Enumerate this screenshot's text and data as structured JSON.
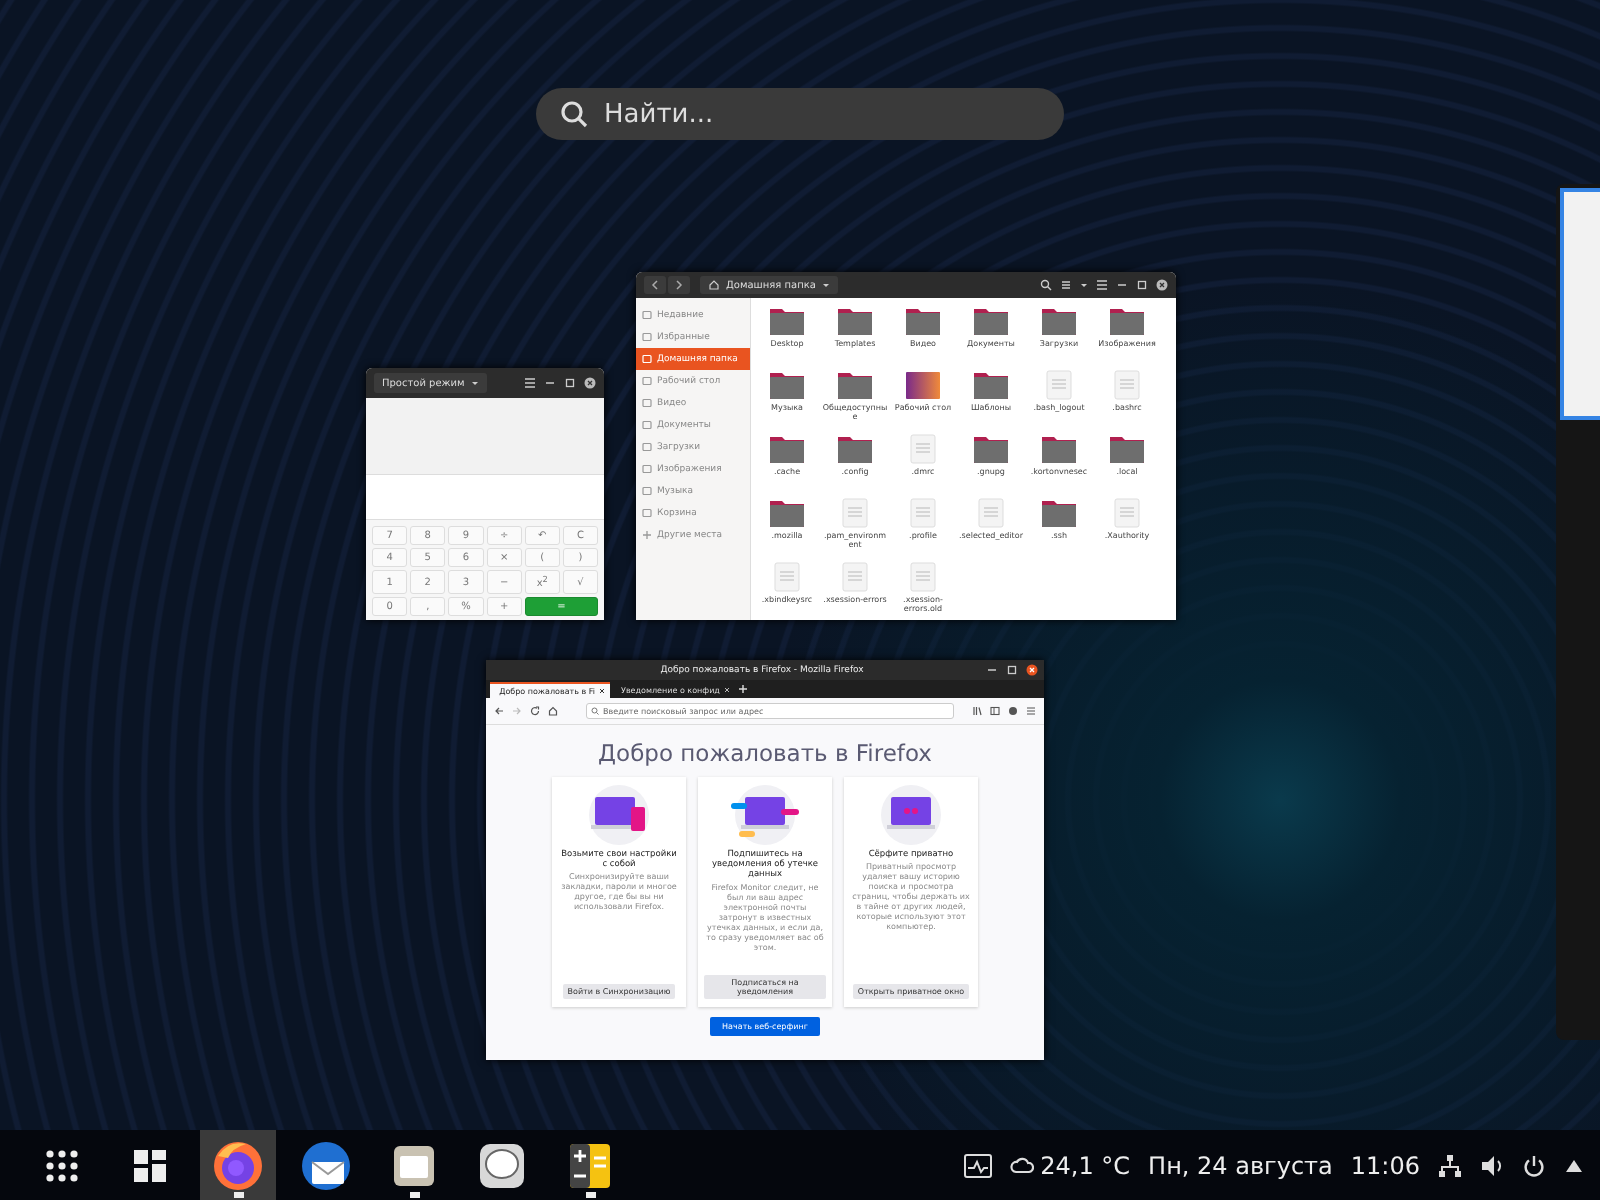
{
  "search": {
    "placeholder": "Найти..."
  },
  "windows": [
    {
      "kind": "calculator",
      "mode": "Простой режим",
      "keys": [
        {
          "label": "7",
          "kind": "key"
        },
        {
          "label": "8",
          "kind": "key"
        },
        {
          "label": "9",
          "kind": "key"
        },
        {
          "label": "÷",
          "kind": "key"
        },
        {
          "label": "↶",
          "kind": "key"
        },
        {
          "label": "C",
          "kind": "key"
        },
        {
          "label": "4",
          "kind": "key"
        },
        {
          "label": "5",
          "kind": "key"
        },
        {
          "label": "6",
          "kind": "key"
        },
        {
          "label": "×",
          "kind": "key"
        },
        {
          "label": "(",
          "kind": "key"
        },
        {
          "label": ")",
          "kind": "key"
        },
        {
          "label": "1",
          "kind": "key"
        },
        {
          "label": "2",
          "kind": "key"
        },
        {
          "label": "3",
          "kind": "key"
        },
        {
          "label": "−",
          "kind": "key"
        },
        {
          "label": "x$^{2}$",
          "kind": "key"
        },
        {
          "label": "√",
          "kind": "key"
        },
        {
          "label": "0",
          "kind": "key"
        },
        {
          "label": ",",
          "kind": "key"
        },
        {
          "label": "%",
          "kind": "key"
        },
        {
          "label": "+",
          "kind": "key"
        },
        {
          "label": "=",
          "kind": "equals"
        }
      ]
    },
    {
      "kind": "files",
      "path": "Домашняя папка",
      "sidebar": [
        {
          "label": "Недавние",
          "kind": "place",
          "selected": false
        },
        {
          "label": "Избранные",
          "kind": "place",
          "selected": false
        },
        {
          "label": "Домашняя папка",
          "kind": "place",
          "selected": true
        },
        {
          "label": "Рабочий стол",
          "kind": "place",
          "selected": false
        },
        {
          "label": "Видео",
          "kind": "place",
          "selected": false
        },
        {
          "label": "Документы",
          "kind": "place",
          "selected": false
        },
        {
          "label": "Загрузки",
          "kind": "place",
          "selected": false
        },
        {
          "label": "Изображения",
          "kind": "place",
          "selected": false
        },
        {
          "label": "Музыка",
          "kind": "place",
          "selected": false
        },
        {
          "label": "Корзина",
          "kind": "place",
          "selected": false
        },
        {
          "label": "Другие места",
          "kind": "add",
          "selected": false
        }
      ],
      "items": [
        {
          "name": "Desktop",
          "kind": "folder"
        },
        {
          "name": "Templates",
          "kind": "folder"
        },
        {
          "name": "Видео",
          "kind": "folder"
        },
        {
          "name": "Документы",
          "kind": "folder"
        },
        {
          "name": "Загрузки",
          "kind": "folder"
        },
        {
          "name": "Изображения",
          "kind": "folder"
        },
        {
          "name": "Музыка",
          "kind": "folder"
        },
        {
          "name": "Общедоступные",
          "kind": "folder"
        },
        {
          "name": "Рабочий стол",
          "kind": "desktop"
        },
        {
          "name": "Шаблоны",
          "kind": "folder"
        },
        {
          "name": ".bash_logout",
          "kind": "file"
        },
        {
          "name": ".bashrc",
          "kind": "file"
        },
        {
          "name": ".cache",
          "kind": "folder"
        },
        {
          "name": ".config",
          "kind": "folder"
        },
        {
          "name": ".dmrc",
          "kind": "file"
        },
        {
          "name": ".gnupg",
          "kind": "folder"
        },
        {
          "name": ".kortonvnesec",
          "kind": "folder"
        },
        {
          "name": ".local",
          "kind": "folder"
        },
        {
          "name": ".mozilla",
          "kind": "folder"
        },
        {
          "name": ".pam_environment",
          "kind": "file"
        },
        {
          "name": ".profile",
          "kind": "file"
        },
        {
          "name": ".selected_editor",
          "kind": "file"
        },
        {
          "name": ".ssh",
          "kind": "folder"
        },
        {
          "name": ".Xauthority",
          "kind": "file"
        },
        {
          "name": ".xbindkeysrc",
          "kind": "file"
        },
        {
          "name": ".xsession-errors",
          "kind": "file"
        },
        {
          "name": ".xsession-errors.old",
          "kind": "file"
        }
      ]
    },
    {
      "kind": "firefox",
      "title": "Добро пожаловать в Firefox - Mozilla Firefox",
      "tabs": [
        {
          "label": "Добро пожаловать в Fi",
          "selected": true
        },
        {
          "label": "Уведомление о конфид",
          "selected": false
        }
      ],
      "url_placeholder": "Введите поисковый запрос или адрес",
      "heading": "Добро пожаловать в Firefox",
      "cards": [
        {
          "title": "Возьмите свои настройки с собой",
          "body": "Синхронизируйте ваши закладки, пароли и многое другое, где бы вы ни использовали Firefox.",
          "button": "Войти в Синхронизацию"
        },
        {
          "title": "Подпишитесь на уведомления об утечке данных",
          "body": "Firefox Monitor следит, не был ли ваш адрес электронной почты затронут в известных утечках данных, и если да, то сразу уведомляет вас об этом.",
          "button": "Подписаться на уведомления"
        },
        {
          "title": "Сёрфите приватно",
          "body": "Приватный просмотр удаляет вашу историю поиска и просмотра страниц, чтобы держать их в тайне от других людей, которые используют этот компьютер.",
          "button": "Открыть приватное окно"
        }
      ],
      "start_button": "Начать веб-серфинг"
    },
    {
      "kind": "thumbnail",
      "selected": true
    }
  ],
  "dock": [
    {
      "kind": "app-grid",
      "active": false,
      "running": false
    },
    {
      "kind": "workspaces",
      "active": false,
      "running": false
    },
    {
      "kind": "firefox",
      "active": true,
      "running": true
    },
    {
      "kind": "mail",
      "active": false,
      "running": false
    },
    {
      "kind": "files",
      "active": false,
      "running": true
    },
    {
      "kind": "chat",
      "active": false,
      "running": false
    },
    {
      "kind": "calculator",
      "active": false,
      "running": true
    }
  ],
  "tray": {
    "weather": "24,1 °C",
    "date": "Пн, 24 августа",
    "time": "11:06"
  }
}
